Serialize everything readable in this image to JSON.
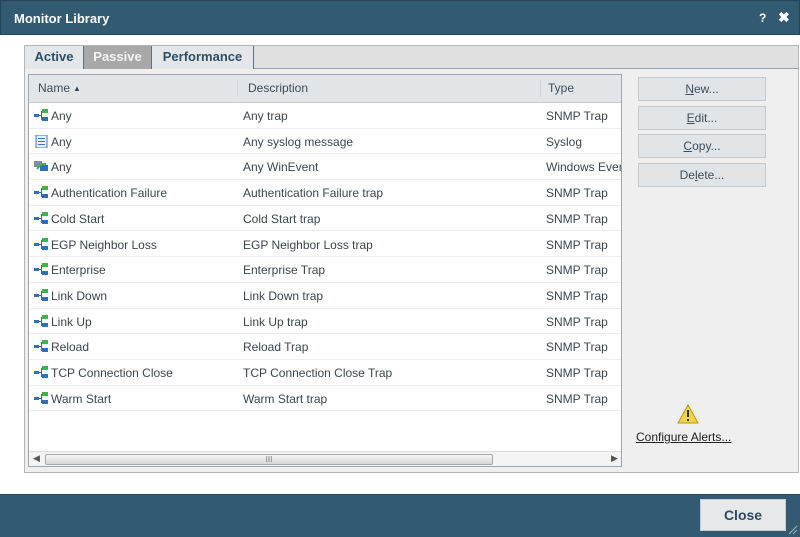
{
  "window": {
    "title": "Monitor Library",
    "help_label": "?",
    "close_label": "✖"
  },
  "tabs": [
    {
      "label": "Active",
      "selected": false
    },
    {
      "label": "Passive",
      "selected": true
    },
    {
      "label": "Performance",
      "selected": false
    }
  ],
  "table": {
    "columns": [
      {
        "label": "Name",
        "sort": "ascending",
        "sort_glyph": "▲"
      },
      {
        "label": "Description"
      },
      {
        "label": "Type"
      }
    ],
    "rows": [
      {
        "icon": "snmp-trap-icon",
        "name": "Any",
        "description": "Any trap",
        "type": "SNMP Trap"
      },
      {
        "icon": "syslog-icon",
        "name": "Any",
        "description": "Any syslog message",
        "type": "Syslog"
      },
      {
        "icon": "windows-event-icon",
        "name": "Any",
        "description": "Any WinEvent",
        "type": "Windows Event"
      },
      {
        "icon": "snmp-trap-icon",
        "name": "Authentication Failure",
        "description": "Authentication Failure trap",
        "type": "SNMP Trap"
      },
      {
        "icon": "snmp-trap-icon",
        "name": "Cold Start",
        "description": "Cold Start trap",
        "type": "SNMP Trap"
      },
      {
        "icon": "snmp-trap-icon",
        "name": "EGP Neighbor Loss",
        "description": "EGP Neighbor Loss trap",
        "type": "SNMP Trap"
      },
      {
        "icon": "snmp-trap-icon",
        "name": "Enterprise",
        "description": "Enterprise Trap",
        "type": "SNMP Trap"
      },
      {
        "icon": "snmp-trap-icon",
        "name": "Link Down",
        "description": "Link Down trap",
        "type": "SNMP Trap"
      },
      {
        "icon": "snmp-trap-icon",
        "name": "Link Up",
        "description": "Link Up trap",
        "type": "SNMP Trap"
      },
      {
        "icon": "snmp-trap-icon",
        "name": "Reload",
        "description": "Reload Trap",
        "type": "SNMP Trap"
      },
      {
        "icon": "snmp-trap-icon",
        "name": "TCP Connection Close",
        "description": "TCP Connection Close Trap",
        "type": "SNMP Trap"
      },
      {
        "icon": "snmp-trap-icon",
        "name": "Warm Start",
        "description": "Warm Start trap",
        "type": "SNMP Trap"
      }
    ],
    "scrollbar": {
      "left_arrow": "◀",
      "right_arrow": "▶",
      "grip": "III"
    }
  },
  "actions": {
    "new": {
      "mnemonic": "N",
      "rest": "ew..."
    },
    "edit": {
      "mnemonic": "E",
      "rest": "dit..."
    },
    "copy": {
      "mnemonic": "C",
      "rest": "opy..."
    },
    "delete": {
      "pre": "De",
      "mnemonic": "l",
      "rest": "ete..."
    }
  },
  "configure_alerts": {
    "label": "Configure Alerts...",
    "icon": "warning-icon"
  },
  "footer": {
    "close_label": "Close"
  },
  "colors": {
    "titlebar": "#335a73",
    "tab_selected": "#a8a8a8",
    "accent_text": "#2f4f66"
  }
}
